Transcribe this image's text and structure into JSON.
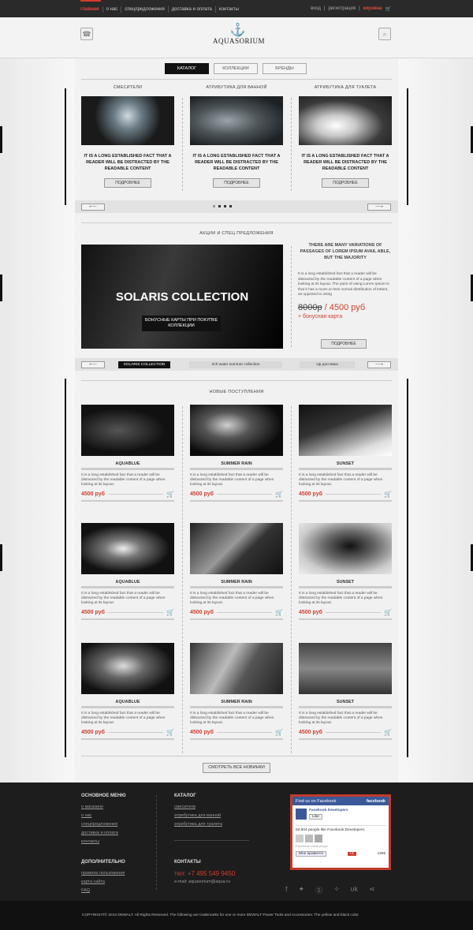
{
  "topnav": [
    "главная",
    "о нас",
    "спецпредложения",
    "доставка и оплата",
    "контакты"
  ],
  "toplinks": {
    "login": "вход",
    "register": "регистрация",
    "cart": "корзина"
  },
  "logo": {
    "text": "AQUASORIUM"
  },
  "tabs": [
    "КАТАЛОГ",
    "КОЛЛЕКЦИИ",
    "БРЕНДЫ"
  ],
  "categories": [
    {
      "title": "СМЕСИТЕЛИ",
      "desc": "IT IS A LONG ESTABLISHED FACT THAT A READER WILL BE DISTRACTED BY THE READABLE CONTENT",
      "button": "ПОДРОБНЕЕ"
    },
    {
      "title": "АТРИБУТИКА ДЛЯ ВАННОЙ",
      "desc": "IT IS A LONG ESTABLISHED FACT THAT A READER WILL BE DISTRACTED BY THE READABLE CONTENT",
      "button": "ПОДРОБНЕЕ"
    },
    {
      "title": "АТРИБУТИКА ДЛЯ ТУАЛЕТА",
      "desc": "IT IS A LONG ESTABLISHED FACT THAT A READER WILL BE DISTRACTED BY THE READABLE CONTENT",
      "button": "ПОДРОБНЕЕ"
    }
  ],
  "promo": {
    "section_title": "АКЦИИ И СПЕЦ ПРЕДЛОЖЕНИЯ",
    "image_title": "SOLARIS COLLECTION",
    "badge": "БОНУСНЫЕ КАРТЫ ПРИ ПОКУПКЕ КОЛЛЕКЦИИ",
    "head": "THERE ARE MANY VARIATIONS OF PASSAGES OF LOREM IPSUM AVAIL ABLE, BUT THE MAJORITY",
    "body": "It is a long established fact that a reader will be distracted by the readable content of a page when looking at its layout. The point of using Lorem Ipsum is that it has a more-or-less normal distribution of letters, as opposed to using",
    "old_price": "8000р",
    "new_price": "/ 4500 руб",
    "bonus": "+ бонусная карта",
    "button": "ПОДРОБНЕЕ",
    "tabs": [
      "SOLARIS COLLECTION",
      "rich water summer collection",
      "vip доставка"
    ]
  },
  "new_section_title": "НОВЫЕ ПОСТУПЛЕНИЯ",
  "products": [
    {
      "name": "AQUABLUE",
      "desc": "It is a long established fact that a reader will be distracted by the readable content of a page when looking at its layout.",
      "price": "4500 руб"
    },
    {
      "name": "SUMMER RAIN",
      "desc": "It is a long established fact that a reader will be distracted by the readable content of a page when looking at its layout.",
      "price": "4500 руб"
    },
    {
      "name": "SUNSET",
      "desc": "It is a long established fact that a reader will be distracted by the readable content of a page when looking at its layout.",
      "price": "4500 руб"
    },
    {
      "name": "AQUABLUE",
      "desc": "It is a long established fact that a reader will be distracted by the readable content of a page when looking at its layout.",
      "price": "4500 руб"
    },
    {
      "name": "SUMMER RAIN",
      "desc": "It is a long established fact that a reader will be distracted by the readable content of a page when looking at its layout.",
      "price": "4500 руб"
    },
    {
      "name": "SUNSET",
      "desc": "It is a long established fact that a reader will be distracted by the readable content of a page when looking at its layout.",
      "price": "4500 руб"
    },
    {
      "name": "AQUABLUE",
      "desc": "It is a long established fact that a reader will be distracted by the readable content of a page when looking at its layout.",
      "price": "4500 руб"
    },
    {
      "name": "SUMMER RAIN",
      "desc": "It is a long established fact that a reader will be distracted by the readable content of a page when looking at its layout.",
      "price": "4500 руб"
    },
    {
      "name": "SUNSET",
      "desc": "It is a long established fact that a reader will be distracted by the readable content of a page when looking at its layout.",
      "price": "4500 руб"
    }
  ],
  "all_new_button": "СМОТРЕТЬ ВСЕ НОВИНКИ",
  "footer": {
    "main_menu": {
      "title": "ОСНОВНОЕ МЕНЮ",
      "items": [
        "о магазине",
        "о нас",
        "спецпредложения",
        "доставка и оплата",
        "контакты"
      ]
    },
    "catalog": {
      "title": "КАТАЛОГ",
      "items": [
        "смесители",
        "атрибутика для ванной",
        "атрибутика для туалета"
      ]
    },
    "extra": {
      "title": "ДОПОЛНИТЕЛЬНО",
      "items": [
        "правила пользования",
        "карта сайта",
        "FAQ"
      ]
    },
    "contacts": {
      "title": "КОНТАКТЫ",
      "phone": "тел: +7 495 549 9450",
      "email": "e-mail: aquasorium@aqua.ru"
    },
    "facebook": {
      "header": "Find us on Facebook",
      "brand": "facebook",
      "page": "Facebook Developers",
      "like": "Like",
      "count": "92,604 people like Facebook Developers.",
      "plugin": "Facebook social plugin",
      "vk_like": "Мне нравится",
      "plus": "+1",
      "plus_count": "139k"
    },
    "copyright": "COPYRIGHT© 2013 DEWALT. All Rights Reserved. The following are trademarks for one or more DEWALT Power Tools and Accessories: The yellow and black color"
  },
  "colors": {
    "accent": "#d23c2c",
    "dark": "#111111",
    "footer": "#1d1d1d"
  }
}
